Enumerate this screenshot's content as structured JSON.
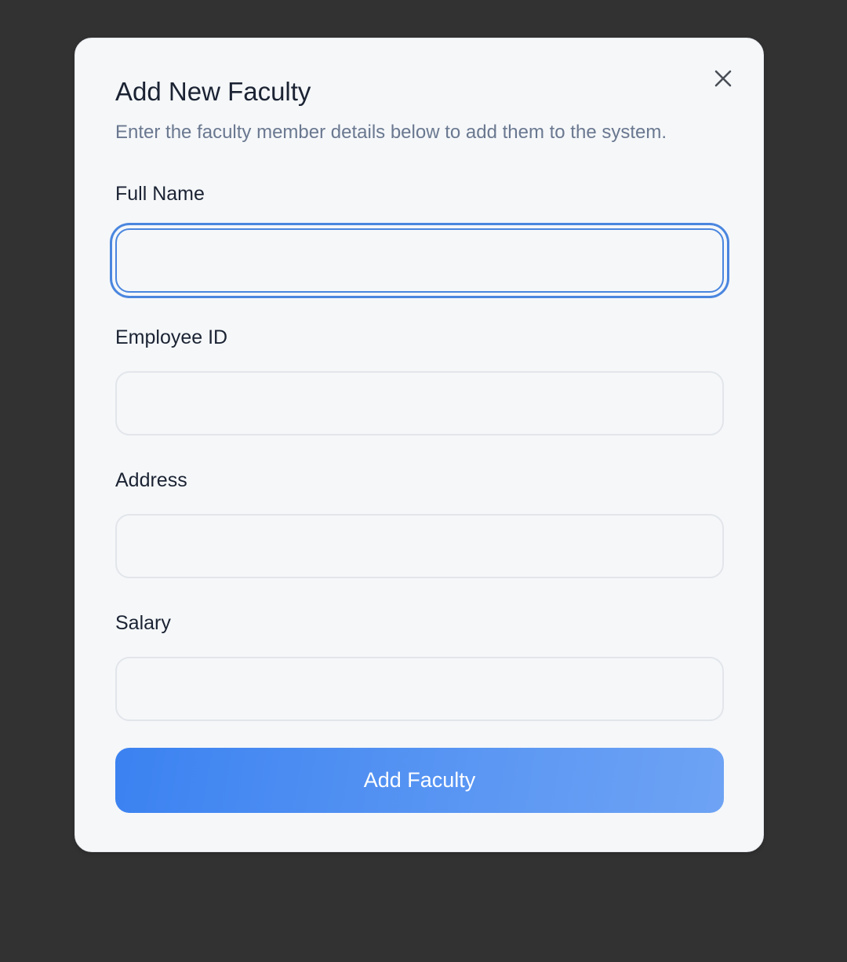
{
  "dialog": {
    "title": "Add New Faculty",
    "subtitle": "Enter the faculty member details below to add them to the system.",
    "close_icon": "close-icon"
  },
  "form": {
    "full_name": {
      "label": "Full Name",
      "value": "",
      "focused": true
    },
    "employee_id": {
      "label": "Employee ID",
      "value": ""
    },
    "address": {
      "label": "Address",
      "value": ""
    },
    "salary": {
      "label": "Salary",
      "value": ""
    },
    "submit_label": "Add Faculty"
  },
  "colors": {
    "backdrop": "#323232",
    "dialog_bg": "#f5f7f9",
    "focus_ring": "#4a86df",
    "button_gradient_start": "#3b82f1",
    "button_gradient_end": "#6ea3f4"
  }
}
